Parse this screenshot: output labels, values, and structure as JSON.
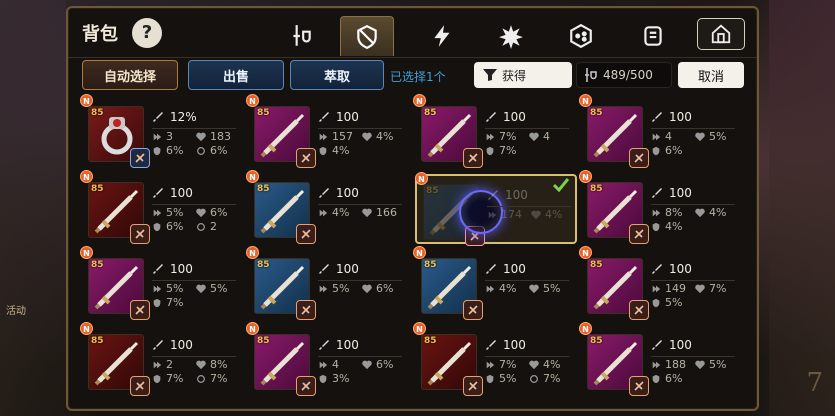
{
  "header": {
    "title": "背包",
    "help_label": "?",
    "tabs": [
      {
        "name": "weapon-tab",
        "icon": "sword-shield-icon",
        "active": false
      },
      {
        "name": "armor-tab",
        "icon": "shield-icon",
        "active": true
      },
      {
        "name": "accessory-tab",
        "icon": "lightning-icon",
        "active": false
      },
      {
        "name": "relic-tab",
        "icon": "burst-icon",
        "active": false
      },
      {
        "name": "dice-tab",
        "icon": "dice-icon",
        "active": false
      },
      {
        "name": "scroll-tab",
        "icon": "scroll-icon",
        "active": false
      }
    ]
  },
  "toolbar": {
    "auto_select_label": "自动选择",
    "sell_label": "出售",
    "extract_label": "萃取",
    "selected_text": "已选择1个",
    "filter_label": "获得",
    "capacity_text": "489/500",
    "cancel_label": "取消"
  },
  "side": {
    "left_label": "活动",
    "right_numeral": "7"
  },
  "colors": {
    "accent_gold": "#b07a3a",
    "accent_blue": "#5d86b8",
    "selected_text": "#3fa0d8"
  },
  "items": [
    {
      "lvl": "85",
      "thumb": "red",
      "kind": "ring",
      "main": "12%",
      "subs": [
        "3",
        "183",
        "6%",
        "6%"
      ],
      "set": "blueb",
      "selected": false
    },
    {
      "lvl": "85",
      "thumb": "purple",
      "kind": "sword",
      "main": "100",
      "subs": [
        "157",
        "4%",
        "4%"
      ],
      "set": "orange",
      "selected": false
    },
    {
      "lvl": "85",
      "thumb": "purple",
      "kind": "sword",
      "main": "100",
      "subs": [
        "7%",
        "4",
        "7%"
      ],
      "set": "orange",
      "selected": false
    },
    {
      "lvl": "85",
      "thumb": "purple",
      "kind": "sword",
      "main": "100",
      "subs": [
        "4",
        "5%",
        "6%"
      ],
      "set": "orange",
      "selected": false
    },
    {
      "lvl": "85",
      "thumb": "dark-red",
      "kind": "sword",
      "main": "100",
      "subs": [
        "5%",
        "6%",
        "6%",
        "2"
      ],
      "set": "orange",
      "selected": false
    },
    {
      "lvl": "85",
      "thumb": "blue",
      "kind": "sword",
      "main": "100",
      "subs": [
        "4%",
        "166"
      ],
      "set": "orange",
      "selected": false
    },
    {
      "lvl": "85",
      "thumb": "blue",
      "kind": "sword",
      "main": "100",
      "subs": [
        "174",
        "4%"
      ],
      "set": "pink",
      "selected": true
    },
    {
      "lvl": "85",
      "thumb": "purple",
      "kind": "sword",
      "main": "100",
      "subs": [
        "8%",
        "4%",
        "4%"
      ],
      "set": "orange",
      "selected": false
    },
    {
      "lvl": "85",
      "thumb": "purple",
      "kind": "sword",
      "main": "100",
      "subs": [
        "5%",
        "5%",
        "7%"
      ],
      "set": "orange",
      "selected": false
    },
    {
      "lvl": "85",
      "thumb": "blue",
      "kind": "sword",
      "main": "100",
      "subs": [
        "5%",
        "6%"
      ],
      "set": "orange",
      "selected": false
    },
    {
      "lvl": "85",
      "thumb": "blue",
      "kind": "sword",
      "main": "100",
      "subs": [
        "4%",
        "5%"
      ],
      "set": "orange",
      "selected": false
    },
    {
      "lvl": "85",
      "thumb": "purple",
      "kind": "sword",
      "main": "100",
      "subs": [
        "149",
        "7%",
        "5%"
      ],
      "set": "orange",
      "selected": false
    },
    {
      "lvl": "85",
      "thumb": "dark-red",
      "kind": "sword",
      "main": "100",
      "subs": [
        "2",
        "8%",
        "7%",
        "7%"
      ],
      "set": "orange",
      "selected": false
    },
    {
      "lvl": "85",
      "thumb": "purple",
      "kind": "sword",
      "main": "100",
      "subs": [
        "4",
        "6%",
        "3%"
      ],
      "set": "orange",
      "selected": false
    },
    {
      "lvl": "85",
      "thumb": "dark-red",
      "kind": "sword",
      "main": "100",
      "subs": [
        "7%",
        "4%",
        "5%",
        "7%"
      ],
      "set": "orange",
      "selected": false
    },
    {
      "lvl": "85",
      "thumb": "purple",
      "kind": "sword",
      "main": "100",
      "subs": [
        "188",
        "5%",
        "6%"
      ],
      "set": "orange",
      "selected": false
    }
  ]
}
